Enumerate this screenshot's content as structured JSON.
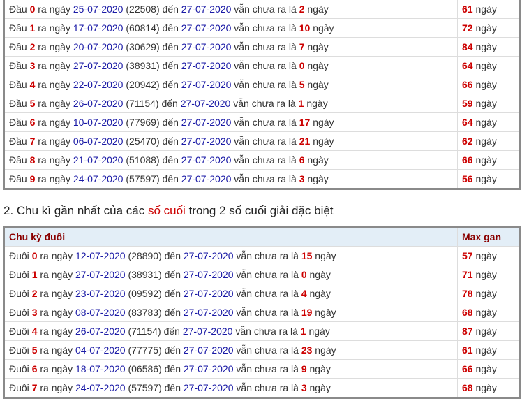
{
  "colors": {
    "number": "#cc0000",
    "date": "#1a1aa6",
    "header_bg": "#e3eef7",
    "header_text": "#8a0000",
    "border": "#8a8a8a"
  },
  "word_ra_ngay": "ra ngày",
  "word_den": "đến",
  "word_van_chua": "vẫn chưa ra là",
  "word_ngay": "ngày",
  "dau_rows": [
    {
      "prefix": "Đầu",
      "digit": "0",
      "date": "25-07-2020",
      "code": "(22508)",
      "to_date": "27-07-2020",
      "days": "2",
      "max": "61"
    },
    {
      "prefix": "Đầu",
      "digit": "1",
      "date": "17-07-2020",
      "code": "(60814)",
      "to_date": "27-07-2020",
      "days": "10",
      "max": "72"
    },
    {
      "prefix": "Đầu",
      "digit": "2",
      "date": "20-07-2020",
      "code": "(30629)",
      "to_date": "27-07-2020",
      "days": "7",
      "max": "84"
    },
    {
      "prefix": "Đầu",
      "digit": "3",
      "date": "27-07-2020",
      "code": "(38931)",
      "to_date": "27-07-2020",
      "days": "0",
      "max": "64"
    },
    {
      "prefix": "Đầu",
      "digit": "4",
      "date": "22-07-2020",
      "code": "(20942)",
      "to_date": "27-07-2020",
      "days": "5",
      "max": "66"
    },
    {
      "prefix": "Đầu",
      "digit": "5",
      "date": "26-07-2020",
      "code": "(71154)",
      "to_date": "27-07-2020",
      "days": "1",
      "max": "59"
    },
    {
      "prefix": "Đầu",
      "digit": "6",
      "date": "10-07-2020",
      "code": "(77969)",
      "to_date": "27-07-2020",
      "days": "17",
      "max": "64"
    },
    {
      "prefix": "Đầu",
      "digit": "7",
      "date": "06-07-2020",
      "code": "(25470)",
      "to_date": "27-07-2020",
      "days": "21",
      "max": "62"
    },
    {
      "prefix": "Đầu",
      "digit": "8",
      "date": "21-07-2020",
      "code": "(51088)",
      "to_date": "27-07-2020",
      "days": "6",
      "max": "66"
    },
    {
      "prefix": "Đầu",
      "digit": "9",
      "date": "24-07-2020",
      "code": "(57597)",
      "to_date": "27-07-2020",
      "days": "3",
      "max": "56"
    }
  ],
  "section2": {
    "title_before": "2. Chu kì gần nhất của các ",
    "title_highlight": "số cuối",
    "title_after": " trong 2 số cuối giải đặc biệt",
    "col1_header": "Chu kỳ đuôi",
    "col2_header": "Max gan"
  },
  "duoi_rows": [
    {
      "prefix": "Đuôi",
      "digit": "0",
      "date": "12-07-2020",
      "code": "(28890)",
      "to_date": "27-07-2020",
      "days": "15",
      "max": "57"
    },
    {
      "prefix": "Đuôi",
      "digit": "1",
      "date": "27-07-2020",
      "code": "(38931)",
      "to_date": "27-07-2020",
      "days": "0",
      "max": "71"
    },
    {
      "prefix": "Đuôi",
      "digit": "2",
      "date": "23-07-2020",
      "code": "(09592)",
      "to_date": "27-07-2020",
      "days": "4",
      "max": "78"
    },
    {
      "prefix": "Đuôi",
      "digit": "3",
      "date": "08-07-2020",
      "code": "(83783)",
      "to_date": "27-07-2020",
      "days": "19",
      "max": "68"
    },
    {
      "prefix": "Đuôi",
      "digit": "4",
      "date": "26-07-2020",
      "code": "(71154)",
      "to_date": "27-07-2020",
      "days": "1",
      "max": "87"
    },
    {
      "prefix": "Đuôi",
      "digit": "5",
      "date": "04-07-2020",
      "code": "(77775)",
      "to_date": "27-07-2020",
      "days": "23",
      "max": "61"
    },
    {
      "prefix": "Đuôi",
      "digit": "6",
      "date": "18-07-2020",
      "code": "(06586)",
      "to_date": "27-07-2020",
      "days": "9",
      "max": "66"
    },
    {
      "prefix": "Đuôi",
      "digit": "7",
      "date": "24-07-2020",
      "code": "(57597)",
      "to_date": "27-07-2020",
      "days": "3",
      "max": "68"
    }
  ]
}
